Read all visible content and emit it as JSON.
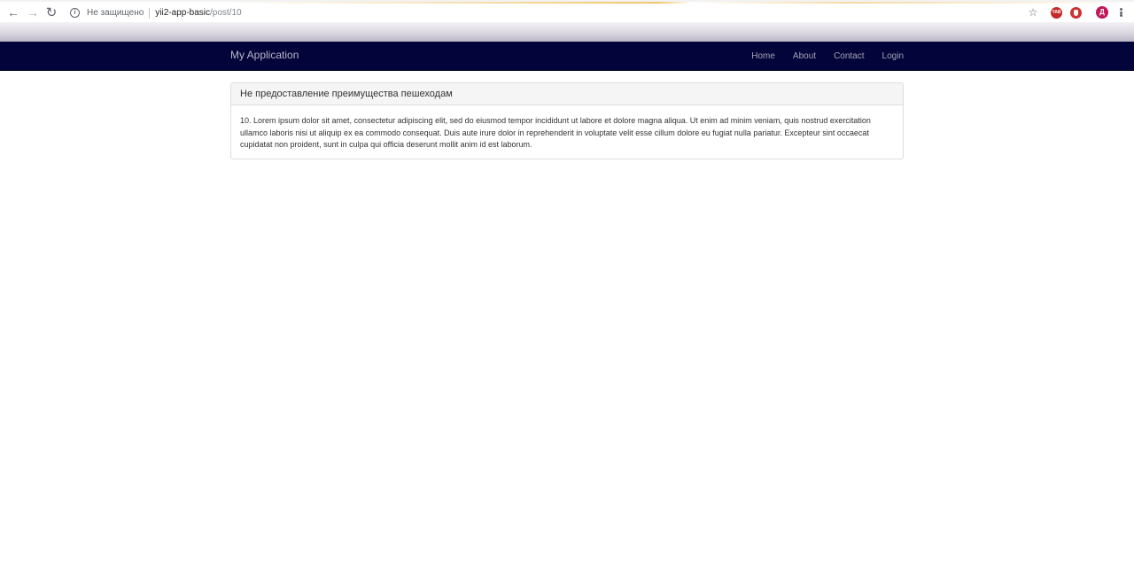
{
  "browser": {
    "insecure_label": "Не защищено",
    "url_host": "yii2-app-basic",
    "url_path": "/post/10",
    "extension_1_label": "YAB",
    "profile_initial": "Д",
    "back_glyph": "←",
    "forward_glyph": "→",
    "reload_glyph": "↻",
    "star_glyph": "☆",
    "info_glyph": "i"
  },
  "navbar": {
    "brand": "My Application",
    "links": [
      "Home",
      "About",
      "Contact",
      "Login"
    ],
    "background": "#03043a"
  },
  "post": {
    "title": "Не предоставление преимущества пешеходам",
    "body": "10. Lorem ipsum dolor sit amet, consectetur adipiscing elit, sed do eiusmod tempor incididunt ut labore et dolore magna aliqua. Ut enim ad minim veniam, quis nostrud exercitation ullamco laboris nisi ut aliquip ex ea commodo consequat. Duis aute irure dolor in reprehenderit in voluptate velit esse cillum dolore eu fugiat nulla pariatur. Excepteur sint occaecat cupidatat non proident, sunt in culpa qui officia deserunt mollit anim id est laborum."
  }
}
